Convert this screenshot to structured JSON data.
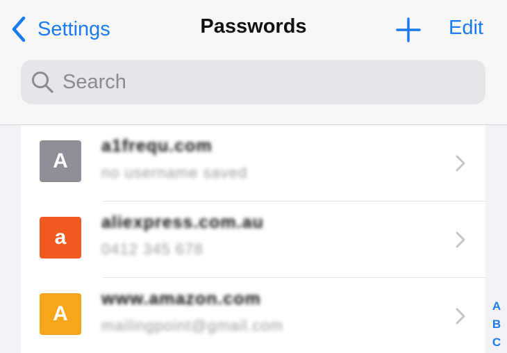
{
  "nav": {
    "back_label": "Settings",
    "title": "Passwords",
    "edit_label": "Edit"
  },
  "search": {
    "placeholder": "Search"
  },
  "rows": [
    {
      "icon_letter": "A",
      "icon_color": "#8e8e96",
      "title": "a1frequ.com",
      "subtitle": "no username saved"
    },
    {
      "icon_letter": "a",
      "icon_color": "#f05a1e",
      "title": "aliexpress.com.au",
      "subtitle": "0412 345 678"
    },
    {
      "icon_letter": "A",
      "icon_color": "#f7a61b",
      "title": "www.amazon.com",
      "subtitle": "mailingpoint@gmail.com"
    }
  ],
  "index_letters": [
    "A",
    "B",
    "C"
  ],
  "colors": {
    "accent": "#1a7af0"
  }
}
